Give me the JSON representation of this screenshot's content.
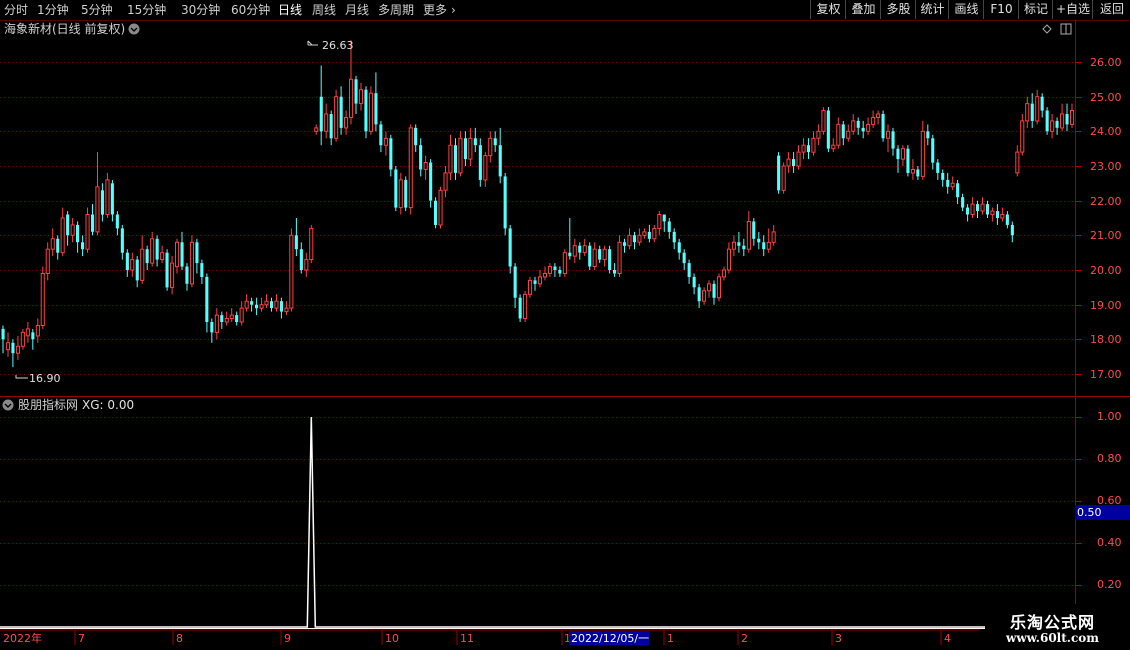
{
  "toolbar": {
    "periods": [
      "分时",
      "1分钟",
      "5分钟",
      "15分钟",
      "30分钟",
      "60分钟",
      "日线",
      "周线",
      "月线",
      "多周期",
      "更多"
    ],
    "active_period": "日线",
    "right_buttons": [
      "复权",
      "叠加",
      "多股",
      "统计",
      "画线",
      "F10",
      "标记",
      "+自选",
      "返回"
    ]
  },
  "main_chart": {
    "title": "海象新材(日线 前复权)",
    "high_label": "26.63",
    "low_label": "16.90",
    "price_ticks": [
      "26.00",
      "25.00",
      "24.00",
      "23.00",
      "22.00",
      "21.00",
      "20.00",
      "19.00",
      "18.00",
      "17.00"
    ]
  },
  "indicator": {
    "title": "股朋指标网",
    "xg_label": "XG: 0.00",
    "ticks": [
      "1.00",
      "0.80",
      "0.60",
      "0.40",
      "0.20"
    ],
    "cursor_value": "0.50"
  },
  "time_axis": {
    "labels": [
      "2022年",
      "7",
      "8",
      "9",
      "10",
      "11",
      "1",
      "1",
      "2",
      "3",
      "4"
    ],
    "cursor_date": "2022/12/05/一"
  },
  "watermark": {
    "title": "乐淘公式网",
    "url": "www.60lt.com"
  },
  "colors": {
    "up": "#ff4040",
    "down": "#54ffff",
    "grid": "#7a0000",
    "axis": "#a00000",
    "cursor_bg": "#0000a0"
  },
  "chart_data": {
    "type": "candlestick",
    "ylim": [
      16.6,
      26.9
    ],
    "candles": [
      [
        18.3,
        18.0,
        18.4,
        17.6
      ],
      [
        17.7,
        17.9,
        18.2,
        17.5
      ],
      [
        17.9,
        17.6,
        18.0,
        17.2
      ],
      [
        17.6,
        17.8,
        18.1,
        17.4
      ],
      [
        17.8,
        18.2,
        18.3,
        17.7
      ],
      [
        18.1,
        18.3,
        18.5,
        17.9
      ],
      [
        18.2,
        18.0,
        18.3,
        17.7
      ],
      [
        18.1,
        18.4,
        18.6,
        17.9
      ],
      [
        18.4,
        19.9,
        20.1,
        18.3
      ],
      [
        19.9,
        20.6,
        20.8,
        19.7
      ],
      [
        20.6,
        20.9,
        21.2,
        20.4
      ],
      [
        20.9,
        20.5,
        21.0,
        20.3
      ],
      [
        20.5,
        21.5,
        21.8,
        20.4
      ],
      [
        21.6,
        21.0,
        21.7,
        20.7
      ],
      [
        21.0,
        21.3,
        21.5,
        20.8
      ],
      [
        21.3,
        20.8,
        21.4,
        20.5
      ],
      [
        20.8,
        20.6,
        21.0,
        20.4
      ],
      [
        20.6,
        21.6,
        21.8,
        20.5
      ],
      [
        21.6,
        21.1,
        21.9,
        21.0
      ],
      [
        21.1,
        22.4,
        23.4,
        21.0
      ],
      [
        22.3,
        21.6,
        22.5,
        21.4
      ],
      [
        21.6,
        22.6,
        22.8,
        21.5
      ],
      [
        22.5,
        21.6,
        22.6,
        21.4
      ],
      [
        21.6,
        21.2,
        21.7,
        21.0
      ],
      [
        21.2,
        20.5,
        21.3,
        20.3
      ],
      [
        20.5,
        20.0,
        20.6,
        19.8
      ],
      [
        20.0,
        20.3,
        20.5,
        19.8
      ],
      [
        20.3,
        19.7,
        20.4,
        19.5
      ],
      [
        19.7,
        20.6,
        21.0,
        19.6
      ],
      [
        20.6,
        20.2,
        20.7,
        20.0
      ],
      [
        20.2,
        20.9,
        21.1,
        20.1
      ],
      [
        20.9,
        20.3,
        21.0,
        20.1
      ],
      [
        20.3,
        20.5,
        20.7,
        20.2
      ],
      [
        20.5,
        19.5,
        20.6,
        19.4
      ],
      [
        19.5,
        20.2,
        20.4,
        19.3
      ],
      [
        20.1,
        20.8,
        20.9,
        19.9
      ],
      [
        20.8,
        20.1,
        21.1,
        20.0
      ],
      [
        20.1,
        19.6,
        20.2,
        19.4
      ],
      [
        19.6,
        20.8,
        21.0,
        19.5
      ],
      [
        20.8,
        20.2,
        20.9,
        19.9
      ],
      [
        20.2,
        19.8,
        20.3,
        19.6
      ],
      [
        19.8,
        18.5,
        19.9,
        18.2
      ],
      [
        18.5,
        18.2,
        18.6,
        17.9
      ],
      [
        18.2,
        18.7,
        18.9,
        18.0
      ],
      [
        18.7,
        18.5,
        18.8,
        18.3
      ],
      [
        18.5,
        18.6,
        18.8,
        18.4
      ],
      [
        18.6,
        18.7,
        18.9,
        18.5
      ],
      [
        18.7,
        18.5,
        18.8,
        18.4
      ],
      [
        18.5,
        18.9,
        19.1,
        18.4
      ],
      [
        18.9,
        19.1,
        19.3,
        18.8
      ],
      [
        19.1,
        19.0,
        19.2,
        18.8
      ],
      [
        19.0,
        18.9,
        19.2,
        18.7
      ],
      [
        18.9,
        19.0,
        19.2,
        18.8
      ],
      [
        19.0,
        19.1,
        19.3,
        18.9
      ],
      [
        19.1,
        18.9,
        19.2,
        18.8
      ],
      [
        18.9,
        19.1,
        19.3,
        18.8
      ],
      [
        19.1,
        18.8,
        19.2,
        18.6
      ],
      [
        18.8,
        18.9,
        19.1,
        18.7
      ],
      [
        18.9,
        21.0,
        21.2,
        18.8
      ],
      [
        21.0,
        20.6,
        21.5,
        20.4
      ],
      [
        20.6,
        20.0,
        20.8,
        19.9
      ],
      [
        20.0,
        20.3,
        20.5,
        19.8
      ],
      [
        20.3,
        21.2,
        21.3,
        20.2
      ],
      [
        24.0,
        24.1,
        24.2,
        23.9
      ],
      [
        25.0,
        24.0,
        25.9,
        23.6
      ],
      [
        24.0,
        24.5,
        24.8,
        23.8
      ],
      [
        24.5,
        23.8,
        24.6,
        23.6
      ],
      [
        23.8,
        25.0,
        25.2,
        23.7
      ],
      [
        25.0,
        24.1,
        25.3,
        23.9
      ],
      [
        24.1,
        24.4,
        24.6,
        23.9
      ],
      [
        24.4,
        25.5,
        26.63,
        24.2
      ],
      [
        25.5,
        24.8,
        25.6,
        24.5
      ],
      [
        24.8,
        25.2,
        25.4,
        24.6
      ],
      [
        25.2,
        24.0,
        25.3,
        23.8
      ],
      [
        24.0,
        25.1,
        25.3,
        23.9
      ],
      [
        25.1,
        24.2,
        25.7,
        24.0
      ],
      [
        24.2,
        23.6,
        24.3,
        23.4
      ],
      [
        23.6,
        23.8,
        24.0,
        23.3
      ],
      [
        23.8,
        22.9,
        23.9,
        22.7
      ],
      [
        22.9,
        21.8,
        23.0,
        21.7
      ],
      [
        21.8,
        22.6,
        22.8,
        21.6
      ],
      [
        22.6,
        21.8,
        22.7,
        21.7
      ],
      [
        21.8,
        24.1,
        24.2,
        21.6
      ],
      [
        24.1,
        23.6,
        24.2,
        23.4
      ],
      [
        23.6,
        22.9,
        23.8,
        22.7
      ],
      [
        22.9,
        23.1,
        23.3,
        22.6
      ],
      [
        23.1,
        22.0,
        23.2,
        21.8
      ],
      [
        22.0,
        21.3,
        22.1,
        21.2
      ],
      [
        21.3,
        22.3,
        22.4,
        21.2
      ],
      [
        22.3,
        22.8,
        23.0,
        22.1
      ],
      [
        22.8,
        23.6,
        23.9,
        22.6
      ],
      [
        23.6,
        22.8,
        23.8,
        22.6
      ],
      [
        22.8,
        23.8,
        24.0,
        22.7
      ],
      [
        23.8,
        23.2,
        24.0,
        23.0
      ],
      [
        23.2,
        23.8,
        24.1,
        23.0
      ],
      [
        23.8,
        23.6,
        24.1,
        23.4
      ],
      [
        23.6,
        22.6,
        23.8,
        22.4
      ],
      [
        22.6,
        23.3,
        23.4,
        22.4
      ],
      [
        23.3,
        23.8,
        24.0,
        23.1
      ],
      [
        23.8,
        23.6,
        24.0,
        23.4
      ],
      [
        23.6,
        22.7,
        24.1,
        22.5
      ],
      [
        22.7,
        21.2,
        22.8,
        21.0
      ],
      [
        21.2,
        20.1,
        21.3,
        19.9
      ],
      [
        20.1,
        19.2,
        20.2,
        18.9
      ],
      [
        19.2,
        18.6,
        19.3,
        18.5
      ],
      [
        18.6,
        19.3,
        19.4,
        18.5
      ],
      [
        19.3,
        19.7,
        19.8,
        19.2
      ],
      [
        19.7,
        19.6,
        19.8,
        19.4
      ],
      [
        19.6,
        19.8,
        20.0,
        19.5
      ],
      [
        19.8,
        19.9,
        20.1,
        19.7
      ],
      [
        19.9,
        20.1,
        20.2,
        19.8
      ],
      [
        20.1,
        20.0,
        20.2,
        19.8
      ],
      [
        20.0,
        19.9,
        20.1,
        19.8
      ],
      [
        19.9,
        20.5,
        20.6,
        19.8
      ],
      [
        20.5,
        20.4,
        21.5,
        20.3
      ],
      [
        20.4,
        20.7,
        20.9,
        20.2
      ],
      [
        20.7,
        20.5,
        20.8,
        20.3
      ],
      [
        20.5,
        20.7,
        20.9,
        20.4
      ],
      [
        20.7,
        20.1,
        20.8,
        20.0
      ],
      [
        20.1,
        20.6,
        20.8,
        20.0
      ],
      [
        20.6,
        20.3,
        20.7,
        20.2
      ],
      [
        20.3,
        20.6,
        20.7,
        20.1
      ],
      [
        20.6,
        20.0,
        20.7,
        19.9
      ],
      [
        20.0,
        19.9,
        20.2,
        19.8
      ],
      [
        19.9,
        20.8,
        21.0,
        19.8
      ],
      [
        20.8,
        20.7,
        20.9,
        20.5
      ],
      [
        20.7,
        21.0,
        21.2,
        20.6
      ],
      [
        21.0,
        20.8,
        21.1,
        20.6
      ],
      [
        20.8,
        21.0,
        21.2,
        20.7
      ],
      [
        21.0,
        21.1,
        21.2,
        20.9
      ],
      [
        21.1,
        20.9,
        21.3,
        20.8
      ],
      [
        20.9,
        21.2,
        21.3,
        20.8
      ],
      [
        21.2,
        21.6,
        21.7,
        21.0
      ],
      [
        21.6,
        21.4,
        21.6,
        21.1
      ],
      [
        21.4,
        21.1,
        21.5,
        20.9
      ],
      [
        21.1,
        20.8,
        21.2,
        20.6
      ],
      [
        20.8,
        20.5,
        20.9,
        20.3
      ],
      [
        20.5,
        20.2,
        20.6,
        20.0
      ],
      [
        20.2,
        19.8,
        20.3,
        19.6
      ],
      [
        19.8,
        19.5,
        19.9,
        19.3
      ],
      [
        19.5,
        19.1,
        19.6,
        18.9
      ],
      [
        19.1,
        19.4,
        19.5,
        19.0
      ],
      [
        19.4,
        19.6,
        19.7,
        19.2
      ],
      [
        19.6,
        19.2,
        19.7,
        19.0
      ],
      [
        19.2,
        19.8,
        19.9,
        19.1
      ],
      [
        19.8,
        20.0,
        20.1,
        19.7
      ],
      [
        20.0,
        20.6,
        20.8,
        19.9
      ],
      [
        20.6,
        20.8,
        21.0,
        20.4
      ],
      [
        20.8,
        20.7,
        21.1,
        20.5
      ],
      [
        20.7,
        20.6,
        20.9,
        20.4
      ],
      [
        20.6,
        21.4,
        21.7,
        20.5
      ],
      [
        21.4,
        20.9,
        21.5,
        20.7
      ],
      [
        20.9,
        20.8,
        21.1,
        20.6
      ],
      [
        20.8,
        20.6,
        21.0,
        20.4
      ],
      [
        20.6,
        20.8,
        21.2,
        20.5
      ],
      [
        20.8,
        21.1,
        21.3,
        20.7
      ],
      [
        23.3,
        22.3,
        23.4,
        22.2
      ],
      [
        22.3,
        23.0,
        23.1,
        22.2
      ],
      [
        23.0,
        23.2,
        23.4,
        22.8
      ],
      [
        23.2,
        23.0,
        23.4,
        22.8
      ],
      [
        23.0,
        23.4,
        23.6,
        22.9
      ],
      [
        23.4,
        23.6,
        23.8,
        23.2
      ],
      [
        23.6,
        23.4,
        23.8,
        23.2
      ],
      [
        23.4,
        23.8,
        24.0,
        23.3
      ],
      [
        23.8,
        24.0,
        24.2,
        23.6
      ],
      [
        24.0,
        24.6,
        24.7,
        23.9
      ],
      [
        24.6,
        23.5,
        24.7,
        23.4
      ],
      [
        23.5,
        23.6,
        23.8,
        23.4
      ],
      [
        23.6,
        24.2,
        24.4,
        23.5
      ],
      [
        24.2,
        23.8,
        24.3,
        23.6
      ],
      [
        23.8,
        24.0,
        24.2,
        23.7
      ],
      [
        24.0,
        24.3,
        24.5,
        23.9
      ],
      [
        24.3,
        24.1,
        24.4,
        23.9
      ],
      [
        24.1,
        24.0,
        24.3,
        23.8
      ],
      [
        24.0,
        24.2,
        24.4,
        23.9
      ],
      [
        24.2,
        24.4,
        24.6,
        24.1
      ],
      [
        24.4,
        24.5,
        24.6,
        24.2
      ],
      [
        24.5,
        23.8,
        24.6,
        23.7
      ],
      [
        23.8,
        24.0,
        24.2,
        23.4
      ],
      [
        24.0,
        23.5,
        24.1,
        23.3
      ],
      [
        23.5,
        23.2,
        23.6,
        22.8
      ],
      [
        23.2,
        23.5,
        23.6,
        23.0
      ],
      [
        23.5,
        22.8,
        23.6,
        22.7
      ],
      [
        22.8,
        22.9,
        23.2,
        22.6
      ],
      [
        22.9,
        22.7,
        23.0,
        22.6
      ],
      [
        22.7,
        24.0,
        24.3,
        22.6
      ],
      [
        24.0,
        23.8,
        24.2,
        23.6
      ],
      [
        23.8,
        23.1,
        23.9,
        22.9
      ],
      [
        23.1,
        22.8,
        23.2,
        22.6
      ],
      [
        22.8,
        22.6,
        22.9,
        22.4
      ],
      [
        22.6,
        22.4,
        22.8,
        22.2
      ],
      [
        22.4,
        22.5,
        22.7,
        22.3
      ],
      [
        22.5,
        22.1,
        22.6,
        21.9
      ],
      [
        22.1,
        21.8,
        22.2,
        21.7
      ],
      [
        21.8,
        21.6,
        21.9,
        21.4
      ],
      [
        21.6,
        21.9,
        22.1,
        21.5
      ],
      [
        21.9,
        21.7,
        22.0,
        21.5
      ],
      [
        21.7,
        21.9,
        22.1,
        21.6
      ],
      [
        21.9,
        21.6,
        22.0,
        21.5
      ],
      [
        21.6,
        21.7,
        21.8,
        21.4
      ],
      [
        21.7,
        21.5,
        21.9,
        21.3
      ],
      [
        21.5,
        21.6,
        21.8,
        21.4
      ],
      [
        21.6,
        21.3,
        21.7,
        21.2
      ],
      [
        21.3,
        21.0,
        21.4,
        20.8
      ],
      [
        22.8,
        23.4,
        23.6,
        22.7
      ],
      [
        23.4,
        24.3,
        24.5,
        23.3
      ],
      [
        24.3,
        24.8,
        25.0,
        24.1
      ],
      [
        24.8,
        24.3,
        25.1,
        24.1
      ],
      [
        24.3,
        25.0,
        25.2,
        24.2
      ],
      [
        25.0,
        24.6,
        25.1,
        24.4
      ],
      [
        24.6,
        24.0,
        24.7,
        23.9
      ],
      [
        24.0,
        24.3,
        24.5,
        23.8
      ],
      [
        24.3,
        24.1,
        24.4,
        23.9
      ],
      [
        24.1,
        24.5,
        24.8,
        24.0
      ],
      [
        24.5,
        24.2,
        24.8,
        24.0
      ],
      [
        24.2,
        24.6,
        24.8,
        24.1
      ]
    ],
    "indicator_xg": {
      "signal_bar_index": 61,
      "value": 1.0,
      "baseline": 0.0
    }
  }
}
